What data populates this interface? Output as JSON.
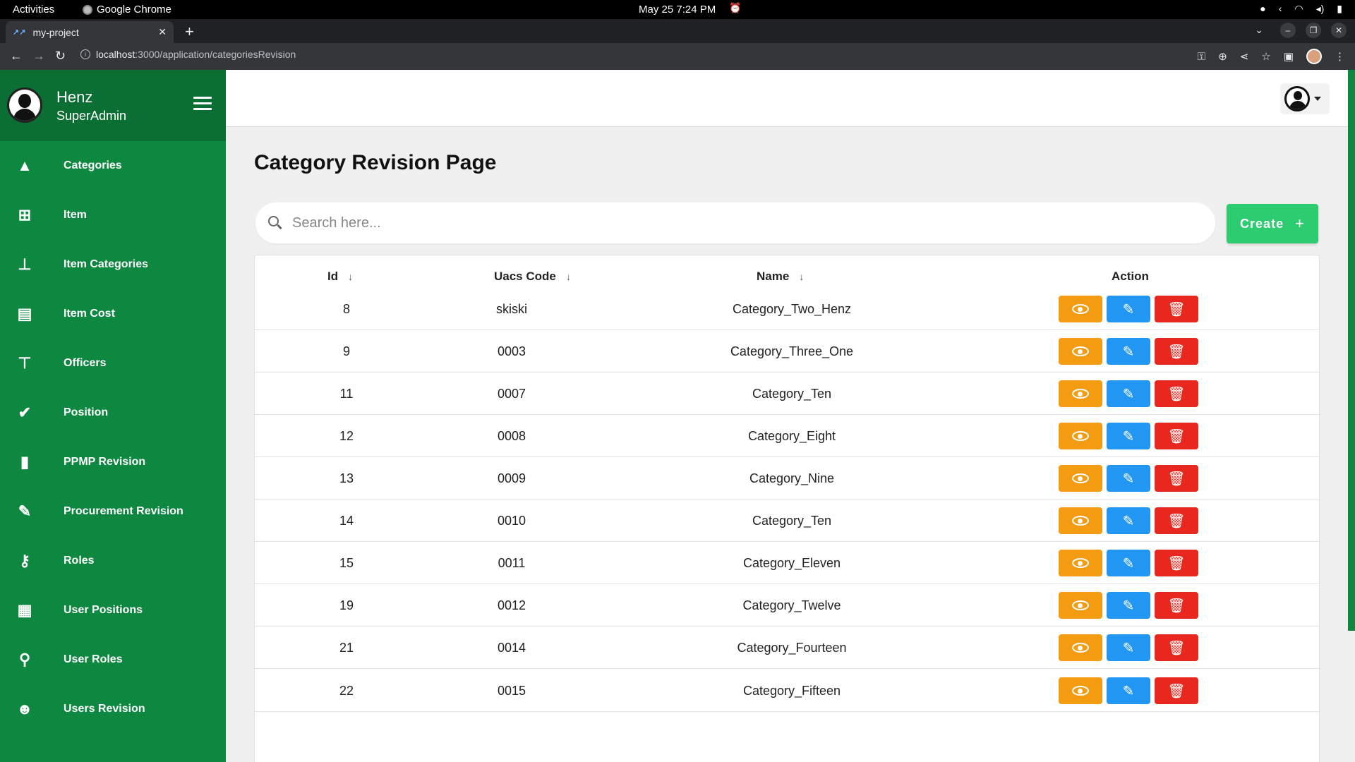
{
  "os": {
    "activities": "Activities",
    "app": "Google Chrome",
    "clock": "May 25  7:24 PM"
  },
  "browser": {
    "tab_title": "my-project",
    "url_host": "localhost",
    "url_path": ":3000/application/categoriesRevision"
  },
  "sidebar": {
    "user_name": "Henz",
    "user_role": "SuperAdmin",
    "items": [
      {
        "label": "Categories",
        "icon": "shapes-icon"
      },
      {
        "label": "Item",
        "icon": "plus-box-icon"
      },
      {
        "label": "Item Categories",
        "icon": "sitemap-icon"
      },
      {
        "label": "Item Cost",
        "icon": "cash-icon"
      },
      {
        "label": "Officers",
        "icon": "chair-icon"
      },
      {
        "label": "Position",
        "icon": "user-check-icon"
      },
      {
        "label": "PPMP Revision",
        "icon": "book-icon"
      },
      {
        "label": "Procurement Revision",
        "icon": "form-edit-icon"
      },
      {
        "label": "Roles",
        "icon": "user-key-icon"
      },
      {
        "label": "User Positions",
        "icon": "building-gear-icon"
      },
      {
        "label": "User Roles",
        "icon": "user-lock-icon"
      },
      {
        "label": "Users Revision",
        "icon": "users-group-icon"
      }
    ]
  },
  "page": {
    "title": "Category Revision Page",
    "search_placeholder": "Search here...",
    "create_label": "Create"
  },
  "table": {
    "columns": [
      "Id",
      "Uacs Code",
      "Name",
      "Action"
    ],
    "rows": [
      {
        "id": "8",
        "uacs": "skiski",
        "name": "Category_Two_Henz"
      },
      {
        "id": "9",
        "uacs": "0003",
        "name": "Category_Three_One"
      },
      {
        "id": "11",
        "uacs": "0007",
        "name": "Category_Ten"
      },
      {
        "id": "12",
        "uacs": "0008",
        "name": "Category_Eight"
      },
      {
        "id": "13",
        "uacs": "0009",
        "name": "Category_Nine"
      },
      {
        "id": "14",
        "uacs": "0010",
        "name": "Category_Ten"
      },
      {
        "id": "15",
        "uacs": "0011",
        "name": "Category_Eleven"
      },
      {
        "id": "19",
        "uacs": "0012",
        "name": "Category_Twelve"
      },
      {
        "id": "21",
        "uacs": "0014",
        "name": "Category_Fourteen"
      },
      {
        "id": "22",
        "uacs": "0015",
        "name": "Category_Fifteen"
      }
    ]
  },
  "colors": {
    "sidebar": "#0e8740",
    "sidebar_header": "#0b6f34",
    "create": "#2ecc71",
    "view": "#f39c12",
    "edit": "#2196f3",
    "delete": "#e8281e"
  }
}
